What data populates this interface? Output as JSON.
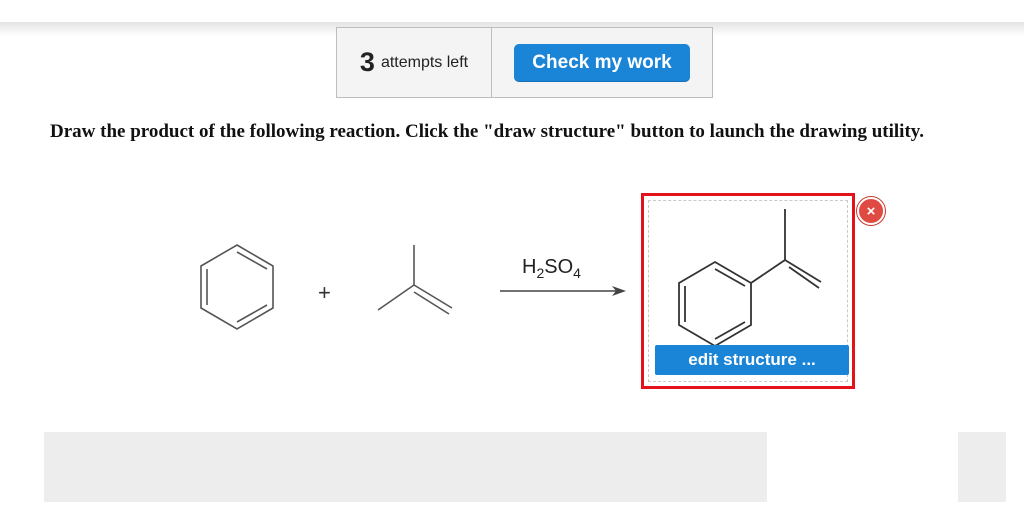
{
  "toolbar": {
    "attempts_count": "3",
    "attempts_label": "attempts left",
    "check_label": "Check my work"
  },
  "question": {
    "prompt": "Draw the product of the following reaction. Click the \"draw structure\" button to launch the drawing utility."
  },
  "reaction": {
    "plus": "+",
    "reagent": {
      "formula_h": "H",
      "formula_h_sub": "2",
      "formula_so": "SO",
      "formula_so_sub": "4"
    }
  },
  "answer": {
    "edit_label": "edit structure ...",
    "close_icon": "×"
  },
  "colors": {
    "accent_blue": "#1a84d6",
    "answer_border": "#e3121b",
    "close_red": "#df4b42"
  }
}
